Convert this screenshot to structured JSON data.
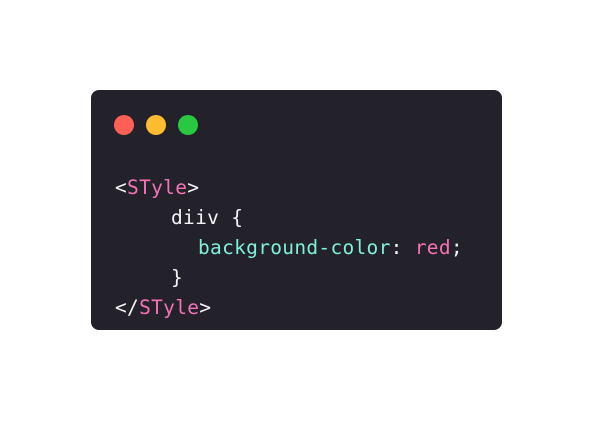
{
  "window": {
    "background": "#23222b",
    "traffic_lights": [
      {
        "name": "close",
        "color": "#ff5f57"
      },
      {
        "name": "minimize",
        "color": "#febc2e"
      },
      {
        "name": "maximize",
        "color": "#28c840"
      }
    ]
  },
  "code": {
    "line1": {
      "open": "<",
      "tag": "STyle",
      "close": ">"
    },
    "line2": {
      "selector": "diiv",
      "brace": " {"
    },
    "line3": {
      "property": "background-color",
      "colon": ": ",
      "value": "red",
      "semicolon": ";"
    },
    "line4": {
      "brace": "}"
    },
    "line5": {
      "open": "</",
      "tag": "STyle",
      "close": ">"
    }
  },
  "colors": {
    "text": "#f4f4f6",
    "tag": "#f472b6",
    "property": "#7ff0dc",
    "value": "#f472b6"
  }
}
